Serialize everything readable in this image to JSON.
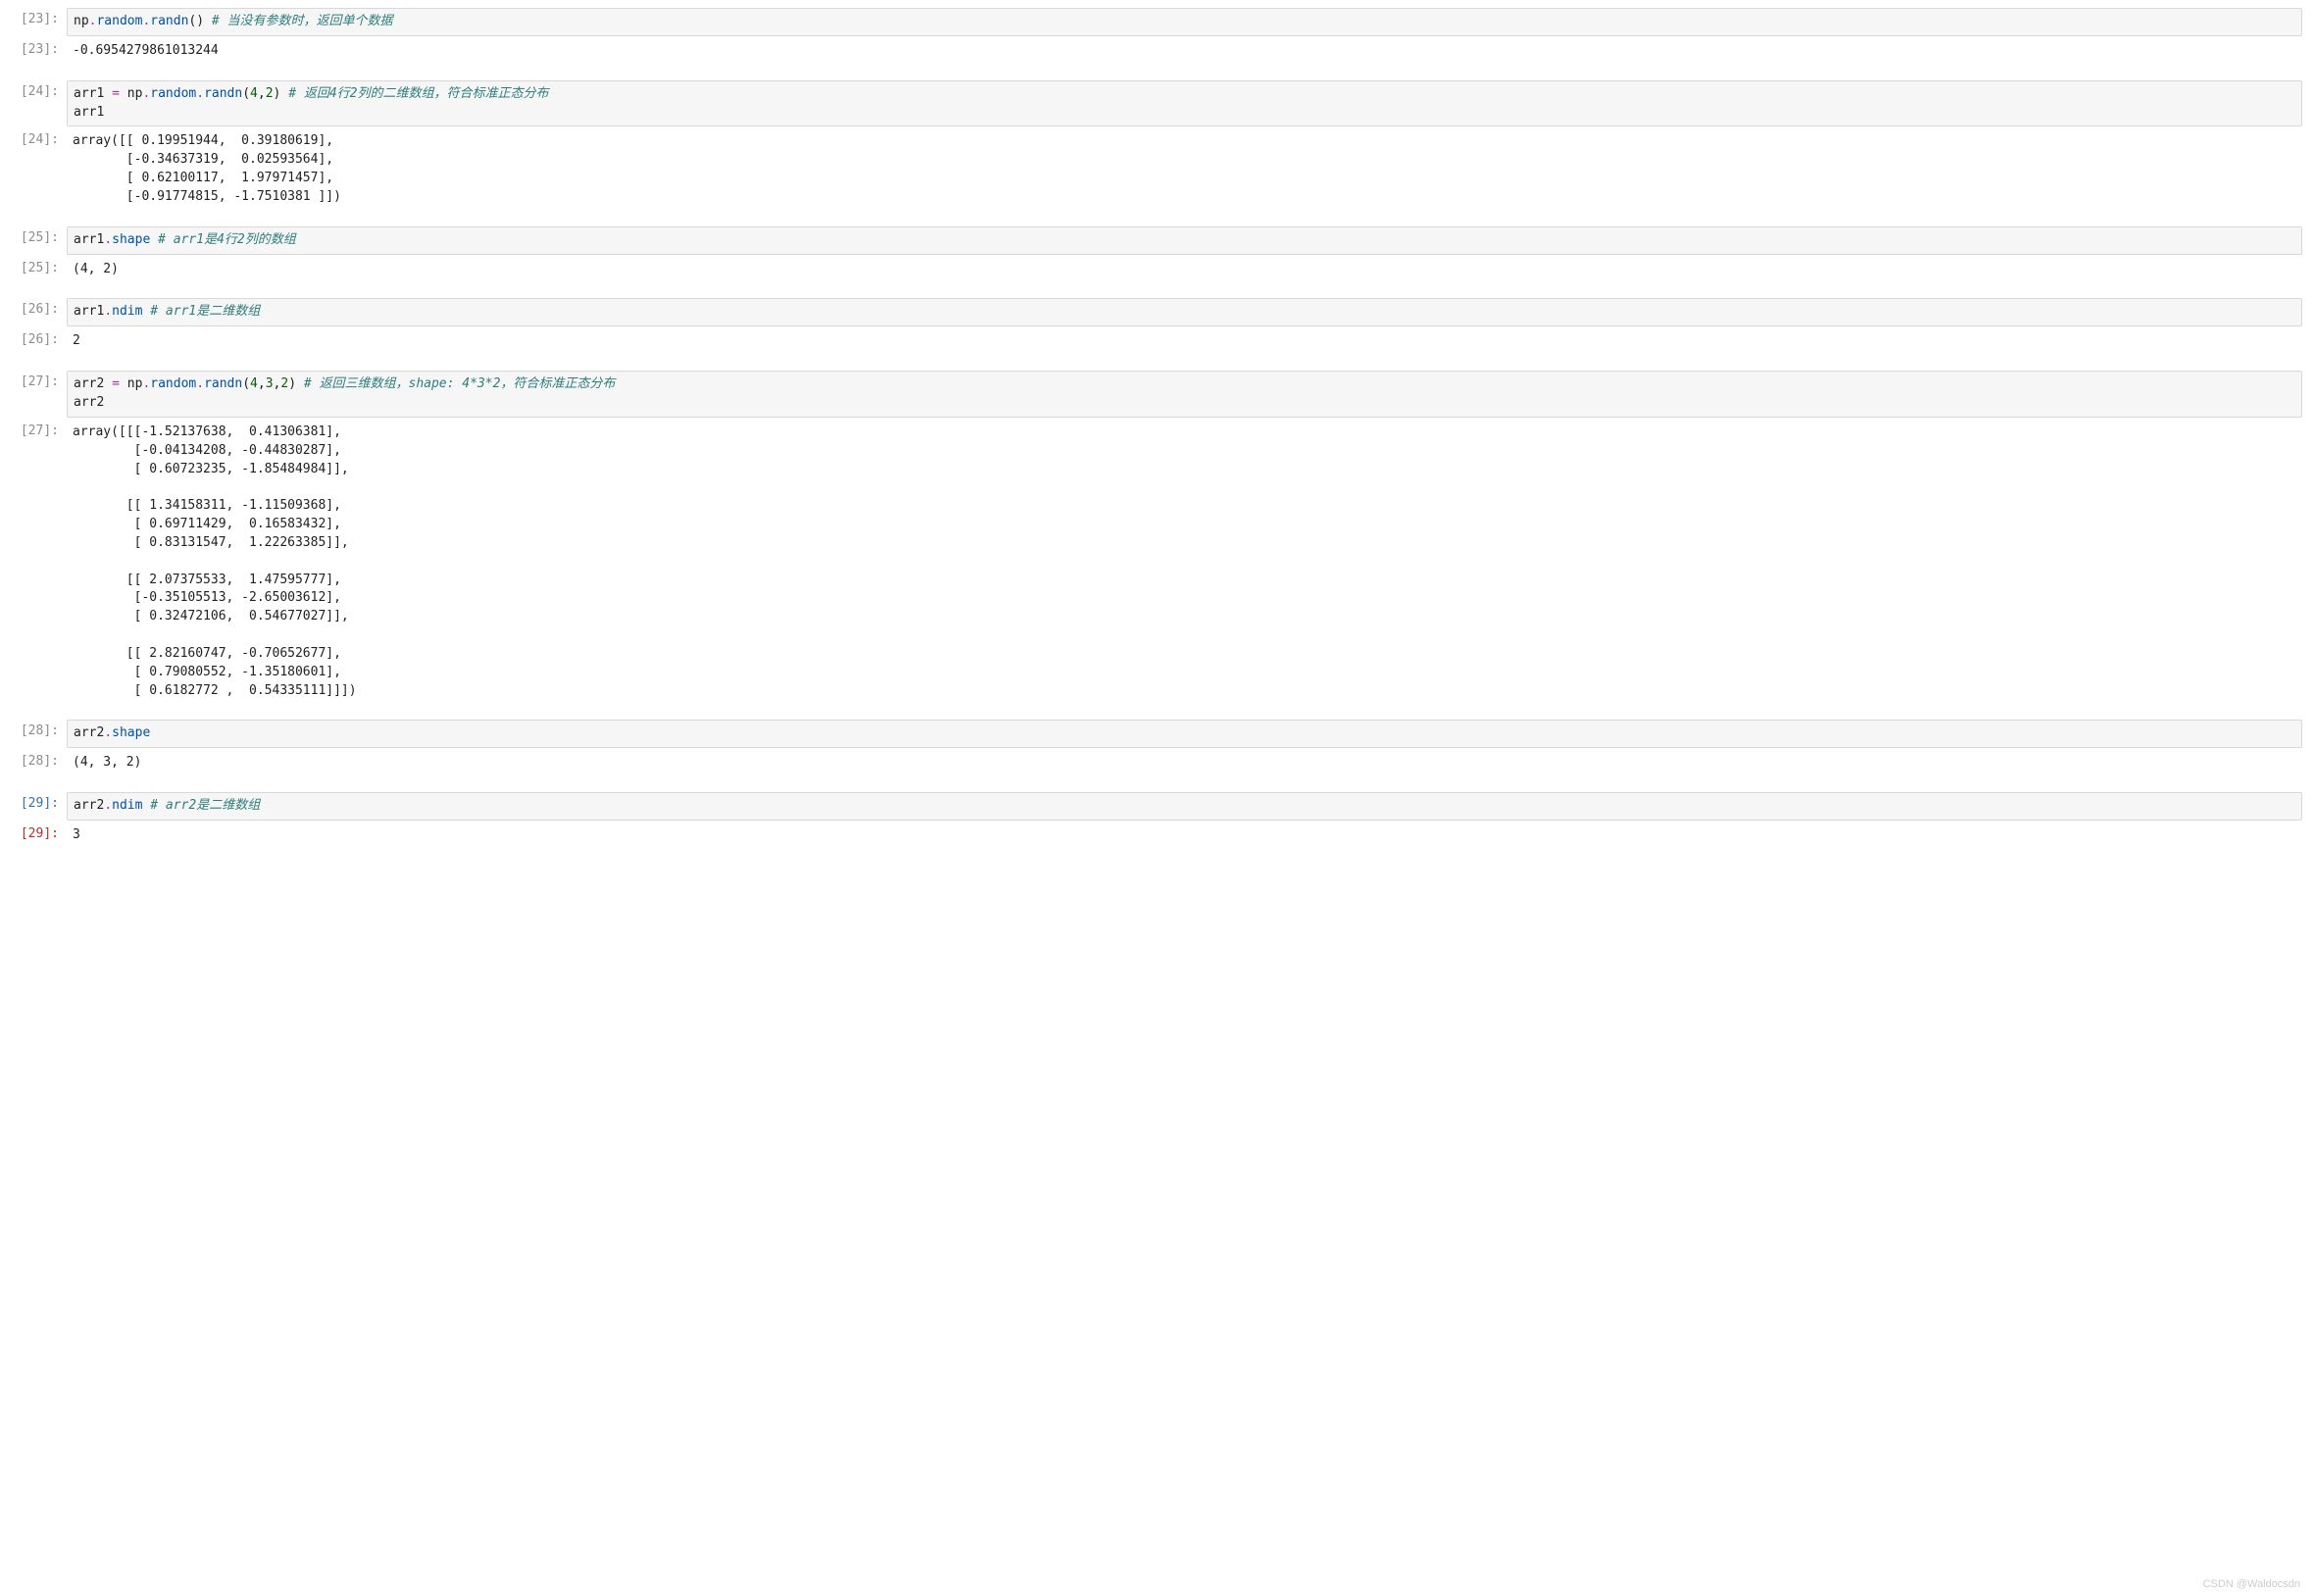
{
  "cells": [
    {
      "num": "23",
      "kind": "in",
      "code_parts": [
        {
          "cls": "tok-name",
          "t": "np"
        },
        {
          "cls": "tok-op",
          "t": "."
        },
        {
          "cls": "tok-attr",
          "t": "random"
        },
        {
          "cls": "tok-op",
          "t": "."
        },
        {
          "cls": "tok-attr",
          "t": "randn"
        },
        {
          "cls": "tok-punct",
          "t": "()"
        },
        {
          "cls": "tok-name",
          "t": " "
        },
        {
          "cls": "tok-comment",
          "t": "# 当没有参数时，返回单个数据"
        }
      ]
    },
    {
      "num": "23",
      "kind": "out",
      "text": "-0.6954279861013244"
    },
    {
      "num": "24",
      "kind": "in",
      "code_parts": [
        {
          "cls": "tok-name",
          "t": "arr1"
        },
        {
          "cls": "tok-name",
          "t": " "
        },
        {
          "cls": "tok-op",
          "t": "="
        },
        {
          "cls": "tok-name",
          "t": " np"
        },
        {
          "cls": "tok-op",
          "t": "."
        },
        {
          "cls": "tok-attr",
          "t": "random"
        },
        {
          "cls": "tok-op",
          "t": "."
        },
        {
          "cls": "tok-attr",
          "t": "randn"
        },
        {
          "cls": "tok-punct",
          "t": "("
        },
        {
          "cls": "tok-num",
          "t": "4"
        },
        {
          "cls": "tok-punct",
          "t": ","
        },
        {
          "cls": "tok-num",
          "t": "2"
        },
        {
          "cls": "tok-punct",
          "t": ")"
        },
        {
          "cls": "tok-name",
          "t": " "
        },
        {
          "cls": "tok-comment",
          "t": "# 返回4行2列的二维数组，符合标准正态分布"
        },
        {
          "cls": "tok-name",
          "t": "\narr1"
        }
      ]
    },
    {
      "num": "24",
      "kind": "out",
      "text": "array([[ 0.19951944,  0.39180619],\n       [-0.34637319,  0.02593564],\n       [ 0.62100117,  1.97971457],\n       [-0.91774815, -1.7510381 ]])"
    },
    {
      "num": "25",
      "kind": "in",
      "code_parts": [
        {
          "cls": "tok-name",
          "t": "arr1"
        },
        {
          "cls": "tok-op",
          "t": "."
        },
        {
          "cls": "tok-attr",
          "t": "shape"
        },
        {
          "cls": "tok-name",
          "t": " "
        },
        {
          "cls": "tok-comment",
          "t": "# arr1是4行2列的数组"
        }
      ]
    },
    {
      "num": "25",
      "kind": "out",
      "text": "(4, 2)"
    },
    {
      "num": "26",
      "kind": "in",
      "code_parts": [
        {
          "cls": "tok-name",
          "t": "arr1"
        },
        {
          "cls": "tok-op",
          "t": "."
        },
        {
          "cls": "tok-attr",
          "t": "ndim"
        },
        {
          "cls": "tok-name",
          "t": " "
        },
        {
          "cls": "tok-comment",
          "t": "# arr1是二维数组"
        }
      ]
    },
    {
      "num": "26",
      "kind": "out",
      "text": "2"
    },
    {
      "num": "27",
      "kind": "in",
      "code_parts": [
        {
          "cls": "tok-name",
          "t": "arr2"
        },
        {
          "cls": "tok-name",
          "t": " "
        },
        {
          "cls": "tok-op",
          "t": "="
        },
        {
          "cls": "tok-name",
          "t": " np"
        },
        {
          "cls": "tok-op",
          "t": "."
        },
        {
          "cls": "tok-attr",
          "t": "random"
        },
        {
          "cls": "tok-op",
          "t": "."
        },
        {
          "cls": "tok-attr",
          "t": "randn"
        },
        {
          "cls": "tok-punct",
          "t": "("
        },
        {
          "cls": "tok-num",
          "t": "4"
        },
        {
          "cls": "tok-punct",
          "t": ","
        },
        {
          "cls": "tok-num",
          "t": "3"
        },
        {
          "cls": "tok-punct",
          "t": ","
        },
        {
          "cls": "tok-num",
          "t": "2"
        },
        {
          "cls": "tok-punct",
          "t": ")"
        },
        {
          "cls": "tok-name",
          "t": " "
        },
        {
          "cls": "tok-comment",
          "t": "# 返回三维数组，shape: 4*3*2，符合标准正态分布"
        },
        {
          "cls": "tok-name",
          "t": "\narr2"
        }
      ]
    },
    {
      "num": "27",
      "kind": "out",
      "text": "array([[[-1.52137638,  0.41306381],\n        [-0.04134208, -0.44830287],\n        [ 0.60723235, -1.85484984]],\n\n       [[ 1.34158311, -1.11509368],\n        [ 0.69711429,  0.16583432],\n        [ 0.83131547,  1.22263385]],\n\n       [[ 2.07375533,  1.47595777],\n        [-0.35105513, -2.65003612],\n        [ 0.32472106,  0.54677027]],\n\n       [[ 2.82160747, -0.70652677],\n        [ 0.79080552, -1.35180601],\n        [ 0.6182772 ,  0.54335111]]])"
    },
    {
      "num": "28",
      "kind": "in",
      "code_parts": [
        {
          "cls": "tok-name",
          "t": "arr2"
        },
        {
          "cls": "tok-op",
          "t": "."
        },
        {
          "cls": "tok-attr",
          "t": "shape"
        }
      ]
    },
    {
      "num": "28",
      "kind": "out",
      "text": "(4, 3, 2)"
    },
    {
      "num": "29",
      "kind": "in",
      "current": true,
      "code_parts": [
        {
          "cls": "tok-name",
          "t": "arr2"
        },
        {
          "cls": "tok-op",
          "t": "."
        },
        {
          "cls": "tok-attr",
          "t": "ndim"
        },
        {
          "cls": "tok-name",
          "t": " "
        },
        {
          "cls": "tok-comment",
          "t": "# arr2是二维数组"
        }
      ]
    },
    {
      "num": "29",
      "kind": "out",
      "current": true,
      "text": "3"
    }
  ],
  "watermark": "CSDN @Waldocsdn"
}
